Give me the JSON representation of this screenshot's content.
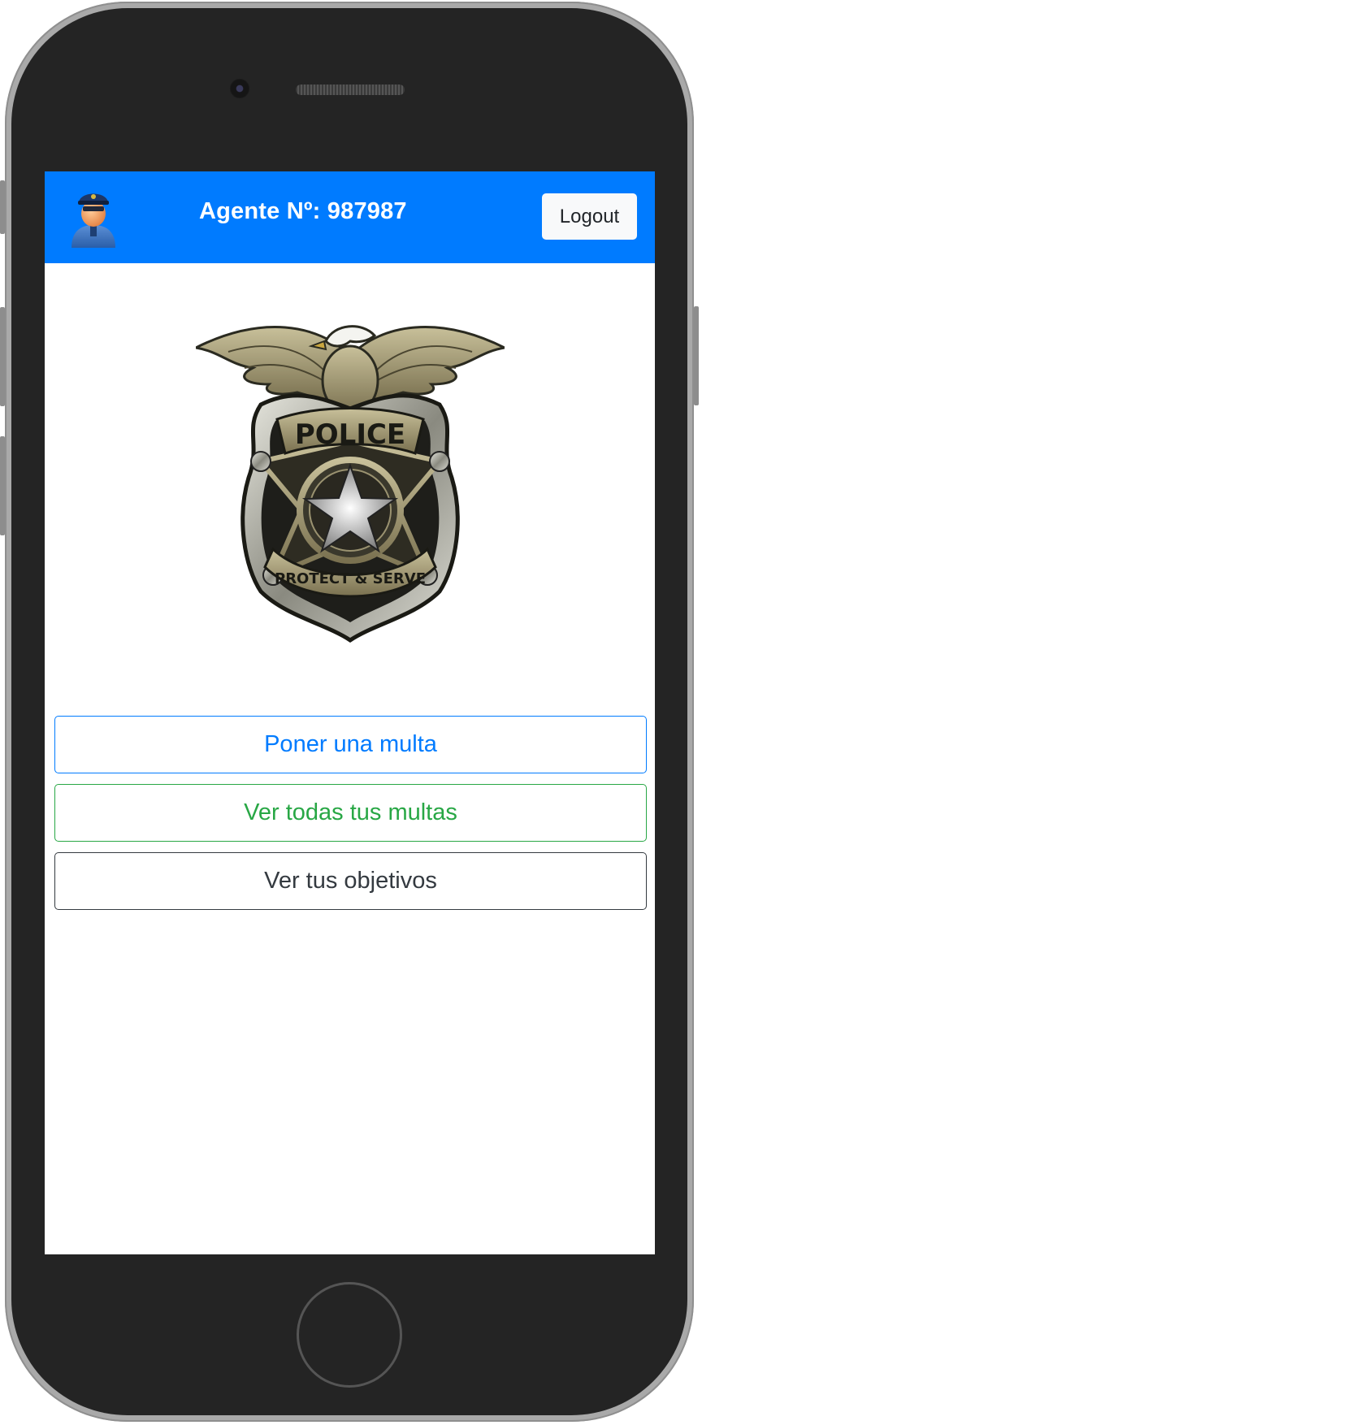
{
  "header": {
    "agent_label": "Agente Nº: 987987",
    "logout_label": "Logout",
    "avatar_icon": "police-officer-icon"
  },
  "badge": {
    "icon": "police-badge-icon",
    "top_text": "POLICE",
    "bottom_text": "PROTECT & SERVE"
  },
  "actions": [
    {
      "label": "Poner una multa",
      "color": "#007bff"
    },
    {
      "label": "Ver todas tus multas",
      "color": "#28a745"
    },
    {
      "label": "Ver tus objetivos",
      "color": "#343a40"
    }
  ],
  "colors": {
    "navbar": "#007bff",
    "frame": "#242424"
  }
}
